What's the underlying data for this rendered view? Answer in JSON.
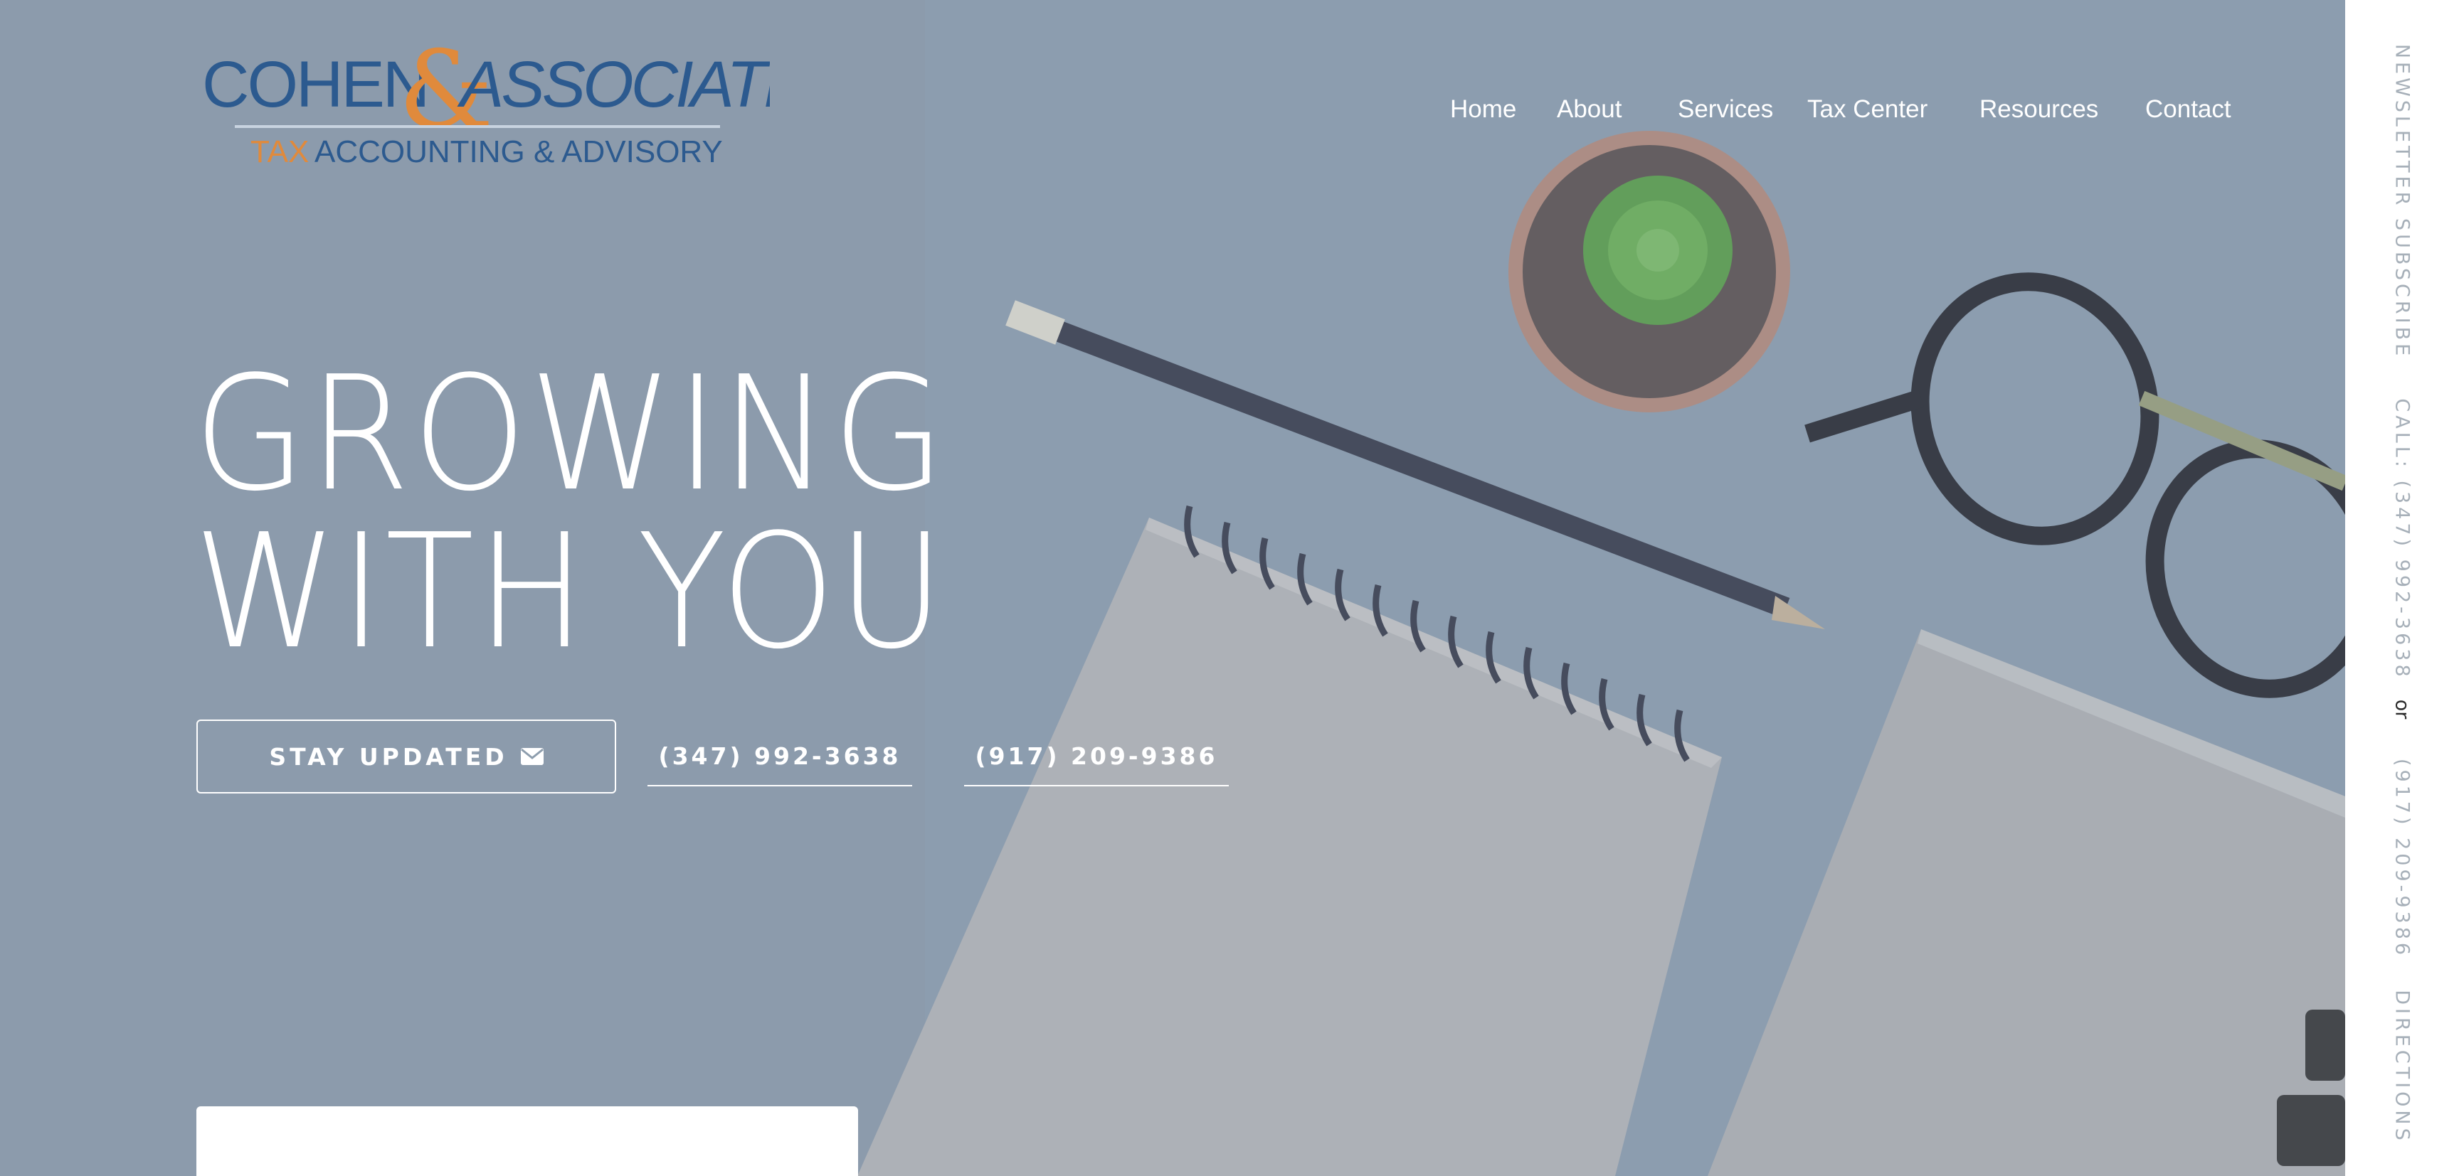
{
  "brand": {
    "name_left": "COHEN",
    "ampersand": "&",
    "name_right": "ASSOCIATES",
    "tagline_accent": "TAX",
    "tagline_rest": "ACCOUNTING & ADVISORY",
    "colors": {
      "blue": "#2c5a8f",
      "orange": "#e08a3c"
    }
  },
  "nav": {
    "items": [
      {
        "label": "Home"
      },
      {
        "label": "About"
      },
      {
        "label": "Services"
      },
      {
        "label": "Tax Center"
      },
      {
        "label": "Resources"
      },
      {
        "label": "Contact"
      }
    ]
  },
  "hero": {
    "headline_line1": "GROWING",
    "headline_line2": "WITH YOU",
    "cta_label": "STAY UPDATED",
    "cta_icon": "envelope-icon",
    "phone1": "(347) 992-3638",
    "phone2": "(917) 209-9386"
  },
  "sidebar": {
    "newsletter": "NEWSLETTER SUBSCRIBE",
    "call": "CALL: (347) 992-3638",
    "or": "or",
    "phone2": "(917) 209-9386",
    "directions": "DIRECTIONS"
  }
}
